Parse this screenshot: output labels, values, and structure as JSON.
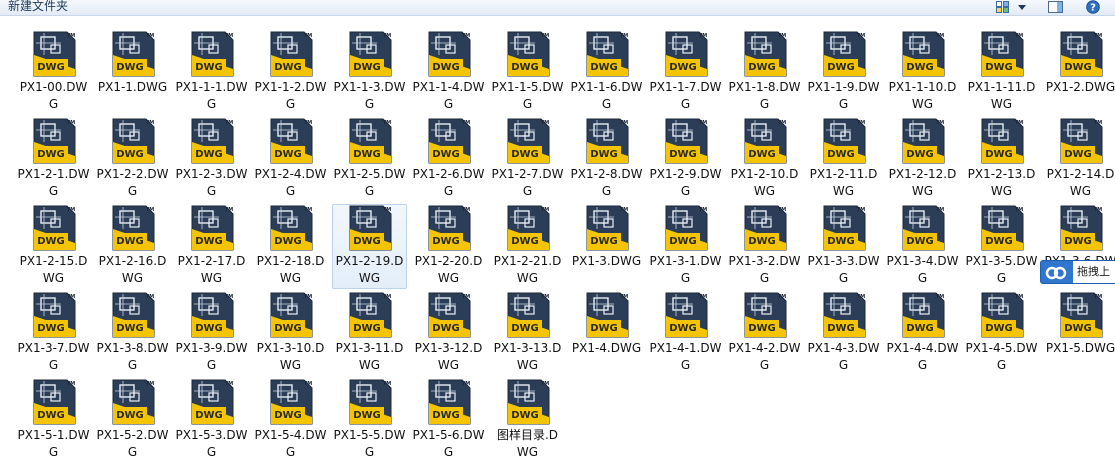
{
  "toolbar": {
    "new_folder_label": "新建文件夹"
  },
  "icons": {
    "file_icon": "dwg-file-icon",
    "view_icon": "view-options-icon",
    "dropdown_icon": "chevron-down-icon",
    "preview_icon": "preview-pane-icon",
    "help_icon": "help-icon"
  },
  "colors": {
    "icon_yellow": "#f4c400",
    "icon_dark": "#2c3e57",
    "selection_border": "#bcd3ee",
    "popup_blue": "#2f76cc"
  },
  "files": [
    {
      "name": "PX1-00.DWG"
    },
    {
      "name": "PX1-1.DWG"
    },
    {
      "name": "PX1-1-1.DWG"
    },
    {
      "name": "PX1-1-2.DWG"
    },
    {
      "name": "PX1-1-3.DWG"
    },
    {
      "name": "PX1-1-4.DWG"
    },
    {
      "name": "PX1-1-5.DWG"
    },
    {
      "name": "PX1-1-6.DWG"
    },
    {
      "name": "PX1-1-7.DWG"
    },
    {
      "name": "PX1-1-8.DWG"
    },
    {
      "name": "PX1-1-9.DWG"
    },
    {
      "name": "PX1-1-10.DWG"
    },
    {
      "name": "PX1-1-11.DWG"
    },
    {
      "name": "PX1-2.DWG"
    },
    {
      "name": "PX1-2-1.DWG"
    },
    {
      "name": "PX1-2-2.DWG"
    },
    {
      "name": "PX1-2-3.DWG"
    },
    {
      "name": "PX1-2-4.DWG"
    },
    {
      "name": "PX1-2-5.DWG"
    },
    {
      "name": "PX1-2-6.DWG"
    },
    {
      "name": "PX1-2-7.DWG"
    },
    {
      "name": "PX1-2-8.DWG"
    },
    {
      "name": "PX1-2-9.DWG"
    },
    {
      "name": "PX1-2-10.DWG"
    },
    {
      "name": "PX1-2-11.DWG"
    },
    {
      "name": "PX1-2-12.DWG"
    },
    {
      "name": "PX1-2-13.DWG"
    },
    {
      "name": "PX1-2-14.DWG"
    },
    {
      "name": "PX1-2-15.DWG"
    },
    {
      "name": "PX1-2-16.DWG"
    },
    {
      "name": "PX1-2-17.DWG"
    },
    {
      "name": "PX1-2-18.DWG"
    },
    {
      "name": "PX1-2-19.DWG",
      "selected": true
    },
    {
      "name": "PX1-2-20.DWG"
    },
    {
      "name": "PX1-2-21.DWG"
    },
    {
      "name": "PX1-3.DWG"
    },
    {
      "name": "PX1-3-1.DWG"
    },
    {
      "name": "PX1-3-2.DWG"
    },
    {
      "name": "PX1-3-3.DWG"
    },
    {
      "name": "PX1-3-4.DWG"
    },
    {
      "name": "PX1-3-5.DWG"
    },
    {
      "name": "PX1-3-6.DWG"
    },
    {
      "name": "PX1-3-7.DWG"
    },
    {
      "name": "PX1-3-8.DWG"
    },
    {
      "name": "PX1-3-9.DWG"
    },
    {
      "name": "PX1-3-10.DWG"
    },
    {
      "name": "PX1-3-11.DWG"
    },
    {
      "name": "PX1-3-12.DWG"
    },
    {
      "name": "PX1-3-13.DWG"
    },
    {
      "name": "PX1-4.DWG"
    },
    {
      "name": "PX1-4-1.DWG"
    },
    {
      "name": "PX1-4-2.DWG"
    },
    {
      "name": "PX1-4-3.DWG"
    },
    {
      "name": "PX1-4-4.DWG"
    },
    {
      "name": "PX1-4-5.DWG"
    },
    {
      "name": "PX1-5.DWG"
    },
    {
      "name": "PX1-5-1.DWG"
    },
    {
      "name": "PX1-5-2.DWG"
    },
    {
      "name": "PX1-5-3.DWG"
    },
    {
      "name": "PX1-5-4.DWG"
    },
    {
      "name": "PX1-5-5.DWG"
    },
    {
      "name": "PX1-5-6.DWG"
    },
    {
      "name": "图样目录.DWG"
    }
  ],
  "popup": {
    "text": "拖拽上",
    "icon": "cloud-icon"
  }
}
